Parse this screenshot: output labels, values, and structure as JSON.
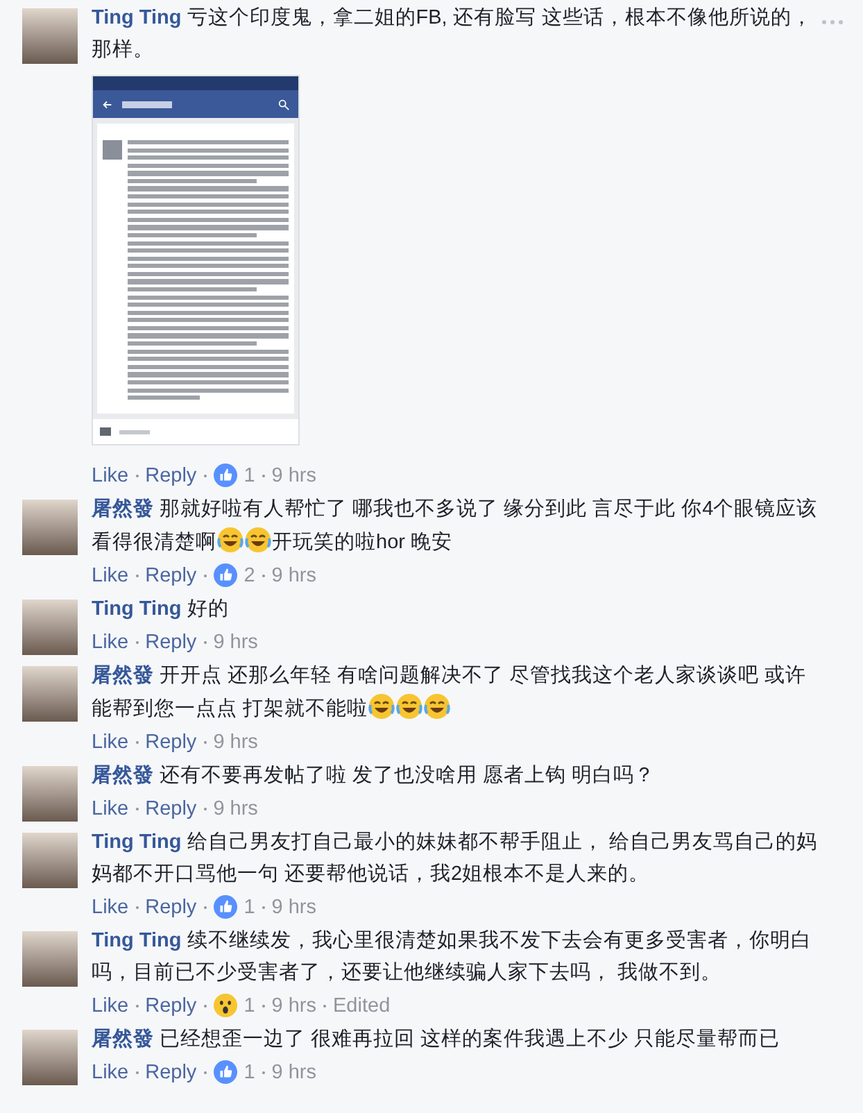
{
  "comments": [
    {
      "author": "Ting Ting",
      "menu": true,
      "parts": [
        {
          "kind": "text",
          "text": "亏这个印度鬼，拿二姐的FB, 还有脸写 这些话，根本不像他所说的，那样。"
        }
      ],
      "attachment": true,
      "actions": {
        "like": "Like",
        "reply": "Reply",
        "reaction": {
          "kind": "like",
          "count": "1"
        },
        "time": "9 hrs"
      }
    },
    {
      "author": "屠然發",
      "parts": [
        {
          "kind": "text",
          "text": "那就好啦有人帮忙了 哪我也不多说了 缘分到此 言尽于此 你4个眼镜应该看得很清楚啊"
        },
        {
          "kind": "emoji"
        },
        {
          "kind": "emoji"
        },
        {
          "kind": "text",
          "text": "开玩笑的啦hor 晚安"
        }
      ],
      "actions": {
        "like": "Like",
        "reply": "Reply",
        "reaction": {
          "kind": "like",
          "count": "2"
        },
        "time": "9 hrs"
      }
    },
    {
      "author": "Ting Ting",
      "parts": [
        {
          "kind": "text",
          "text": "好的"
        }
      ],
      "actions": {
        "like": "Like",
        "reply": "Reply",
        "time": "9 hrs"
      }
    },
    {
      "author": "屠然發",
      "parts": [
        {
          "kind": "text",
          "text": "开开点 还那么年轻 有啥问题解决不了 尽管找我这个老人家谈谈吧 或许能帮到您一点点 打架就不能啦"
        },
        {
          "kind": "emoji"
        },
        {
          "kind": "emoji"
        },
        {
          "kind": "emoji"
        }
      ],
      "actions": {
        "like": "Like",
        "reply": "Reply",
        "time": "9 hrs"
      }
    },
    {
      "author": "屠然發",
      "parts": [
        {
          "kind": "text",
          "text": "还有不要再发帖了啦 发了也没啥用 愿者上钩 明白吗？"
        }
      ],
      "actions": {
        "like": "Like",
        "reply": "Reply",
        "time": "9 hrs"
      }
    },
    {
      "author": "Ting Ting",
      "parts": [
        {
          "kind": "text",
          "text": "给自己男友打自己最小的妹妹都不帮手阻止， 给自己男友骂自己的妈妈都不开口骂他一句 还要帮他说话，我2姐根本不是人来的。"
        }
      ],
      "actions": {
        "like": "Like",
        "reply": "Reply",
        "reaction": {
          "kind": "like",
          "count": "1"
        },
        "time": "9 hrs"
      }
    },
    {
      "author": "Ting Ting",
      "parts": [
        {
          "kind": "text",
          "text": "续不继续发，我心里很清楚如果我不发下去会有更多受害者，你明白吗，目前已不少受害者了，还要让他继续骗人家下去吗， 我做不到。"
        }
      ],
      "actions": {
        "like": "Like",
        "reply": "Reply",
        "reaction": {
          "kind": "wow",
          "count": "1"
        },
        "time": "9 hrs",
        "edited": true,
        "edited_label": "Edited"
      }
    },
    {
      "author": "屠然發",
      "parts": [
        {
          "kind": "text",
          "text": "已经想歪一边了 很难再拉回 这样的案件我遇上不少 只能尽量帮而已"
        }
      ],
      "actions": {
        "like": "Like",
        "reply": "Reply",
        "reaction": {
          "kind": "like",
          "count": "1"
        },
        "time": "9 hrs"
      }
    }
  ]
}
